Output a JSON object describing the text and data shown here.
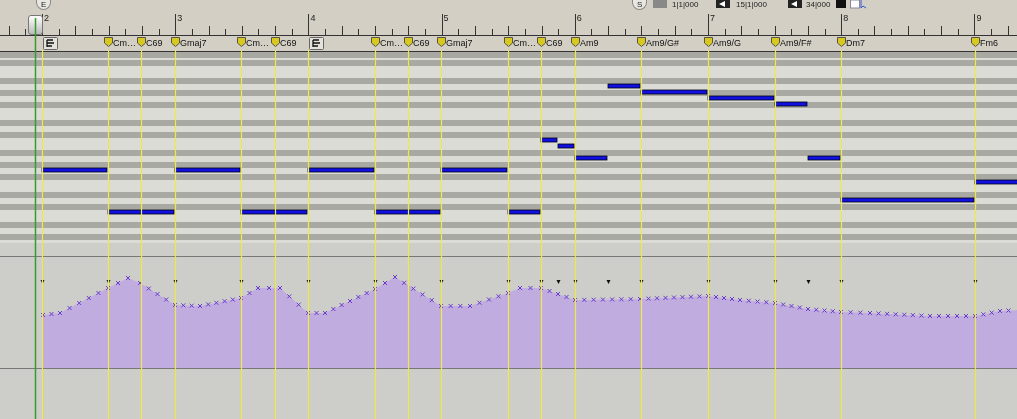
{
  "toolbar": {
    "buttons": [
      "E",
      "S"
    ],
    "counters": [
      "1|1|000",
      "15|1|000",
      "34|000"
    ]
  },
  "ruler": {
    "bars": [
      "2",
      "3",
      "4",
      "5",
      "6",
      "7",
      "8",
      "9"
    ]
  },
  "chords": [
    {
      "kind": "marker"
    },
    {
      "kind": "chord",
      "label": "Cm…"
    },
    {
      "kind": "chord",
      "label": "C69"
    },
    {
      "kind": "chord",
      "label": "Gmaj7"
    },
    {
      "kind": "chord",
      "label": "Cm…"
    },
    {
      "kind": "chord",
      "label": "C69"
    },
    {
      "kind": "marker"
    },
    {
      "kind": "chord",
      "label": "Cm…"
    },
    {
      "kind": "chord",
      "label": "C69"
    },
    {
      "kind": "chord",
      "label": "Gmaj7"
    },
    {
      "kind": "chord",
      "label": "Cm…"
    },
    {
      "kind": "chord",
      "label": "C69"
    },
    {
      "kind": "chord",
      "label": "Am9"
    },
    {
      "kind": "chord",
      "label": "Am9/G#"
    },
    {
      "kind": "chord",
      "label": "Am9/G"
    },
    {
      "kind": "chord",
      "label": "Am9/F#"
    },
    {
      "kind": "chord",
      "label": "Dm7"
    },
    {
      "kind": "chord",
      "label": "Fm6"
    }
  ]
}
